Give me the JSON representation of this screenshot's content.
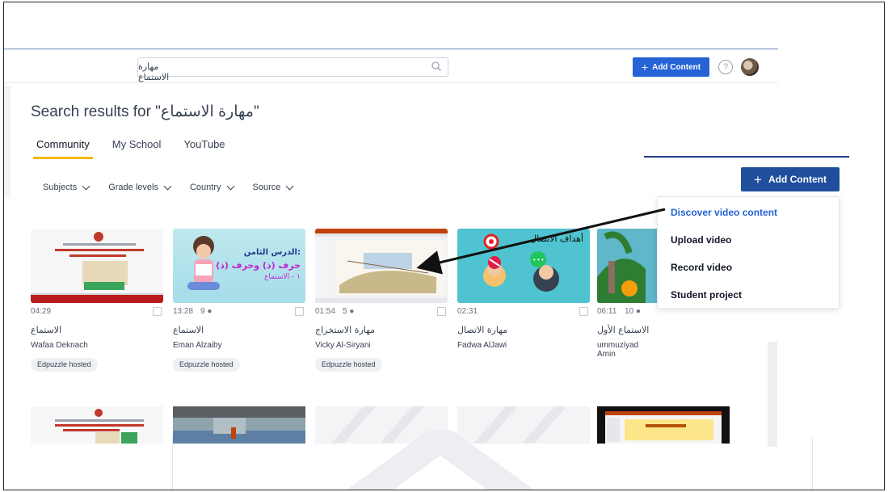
{
  "header": {
    "search_value": "مهارة الاستماع",
    "add_content_label": "Add Content",
    "help_icon": "?"
  },
  "page": {
    "title": "Search results for \"مهارة الاستماع\""
  },
  "tabs": [
    "Community",
    "My School",
    "YouTube"
  ],
  "filters": [
    "Subjects",
    "Grade levels",
    "Country",
    "Source"
  ],
  "cards": [
    {
      "duration": "04:29",
      "questions": "",
      "title": "الاستماع",
      "author": "Wafaa Deknach",
      "badge": "Edpuzzle hosted"
    },
    {
      "duration": "13:28",
      "questions": "9",
      "title": "الاستماع",
      "author": "Eman Alzaiby",
      "badge": "Edpuzzle hosted"
    },
    {
      "duration": "01:54",
      "questions": "5",
      "title": "مهارة الاستخراج",
      "author": "Vicky Al-Siryani",
      "badge": "Edpuzzle hosted"
    },
    {
      "duration": "02:31",
      "questions": "",
      "title": "مهارة الاتصال",
      "author": "Fadwa AlJawi",
      "badge": ""
    },
    {
      "duration": "06:11",
      "questions": "10",
      "title": "الاستماع الأول",
      "author": "ummuziyad Amin",
      "badge": ""
    }
  ],
  "thumb_text": {
    "card2_line1": "الدرس الثامن:",
    "card2_line2": "حرف (ذ) وحرف (ذ)",
    "card2_line3": "١ - الاستماع",
    "card4_heading": "أهداف الاتصال"
  },
  "dropdown": {
    "button_label": "Add Content",
    "items": [
      "Discover video content",
      "Upload video",
      "Record video",
      "Student project"
    ]
  },
  "colors": {
    "primary": "#2563d6",
    "primary_dark": "#1f4e9c",
    "tab_underline": "#f2b705"
  }
}
